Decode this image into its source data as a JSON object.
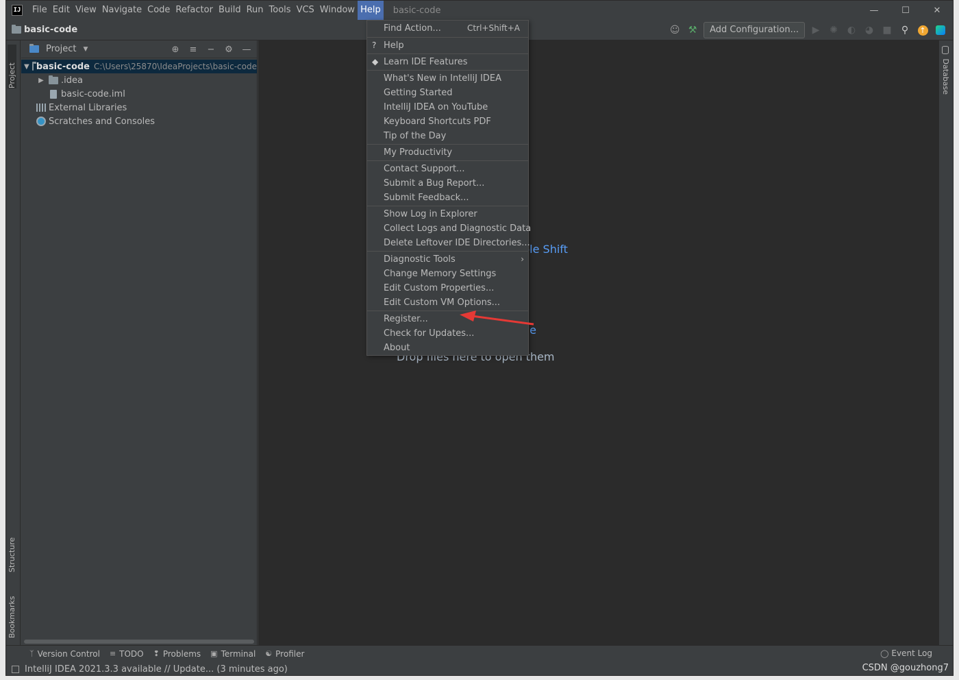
{
  "titlebar": {
    "logo": "IJ",
    "window_title": "basic-code",
    "menu": [
      "File",
      "Edit",
      "View",
      "Navigate",
      "Code",
      "Refactor",
      "Build",
      "Run",
      "Tools",
      "VCS",
      "Window",
      "Help"
    ],
    "controls": {
      "minimize": "—",
      "maximize": "☐",
      "close": "✕"
    }
  },
  "navbar": {
    "project_name": "basic-code",
    "add_configuration": "Add Configuration..."
  },
  "left_strip": {
    "project": "Project",
    "structure": "Structure",
    "bookmarks": "Bookmarks"
  },
  "right_strip": {
    "database": "Database"
  },
  "project_panel": {
    "title": "Project",
    "tree": [
      {
        "label": "basic-code",
        "path": "C:\\Users\\25870\\IdeaProjects\\basic-code"
      },
      {
        "label": ".idea"
      },
      {
        "label": "basic-code.iml"
      },
      {
        "label": "External Libraries"
      },
      {
        "label": "Scratches and Consoles"
      }
    ]
  },
  "editor": {
    "hint_shift": "ble Shift",
    "hint_ne": "ne",
    "hint_drop": "Drop files here to open them"
  },
  "help_menu": {
    "items": [
      {
        "label": "Find Action...",
        "shortcut": "Ctrl+Shift+A"
      },
      {
        "label": "Help",
        "lead": "?"
      },
      {
        "label": "Learn IDE Features"
      },
      {
        "label": "What's New in IntelliJ IDEA"
      },
      {
        "label": "Getting Started"
      },
      {
        "label": "IntelliJ IDEA on YouTube"
      },
      {
        "label": "Keyboard Shortcuts PDF"
      },
      {
        "label": "Tip of the Day"
      },
      {
        "label": "My Productivity"
      },
      {
        "label": "Contact Support..."
      },
      {
        "label": "Submit a Bug Report..."
      },
      {
        "label": "Submit Feedback..."
      },
      {
        "label": "Show Log in Explorer"
      },
      {
        "label": "Collect Logs and Diagnostic Data"
      },
      {
        "label": "Delete Leftover IDE Directories..."
      },
      {
        "label": "Diagnostic Tools"
      },
      {
        "label": "Change Memory Settings"
      },
      {
        "label": "Edit Custom Properties..."
      },
      {
        "label": "Edit Custom VM Options..."
      },
      {
        "label": "Register..."
      },
      {
        "label": "Check for Updates..."
      },
      {
        "label": "About"
      }
    ]
  },
  "toolwindows": {
    "version_control": "Version Control",
    "todo": "TODO",
    "problems": "Problems",
    "terminal": "Terminal",
    "profiler": "Profiler",
    "event_log": "Event Log"
  },
  "statusbar": {
    "message": "IntelliJ IDEA 2021.3.3 available // Update... (3 minutes ago)",
    "watermark": "CSDN @gouzhong7"
  },
  "colors": {
    "accent": "#4b6eaf",
    "link": "#589df6",
    "annotation_arrow": "#e53935"
  }
}
